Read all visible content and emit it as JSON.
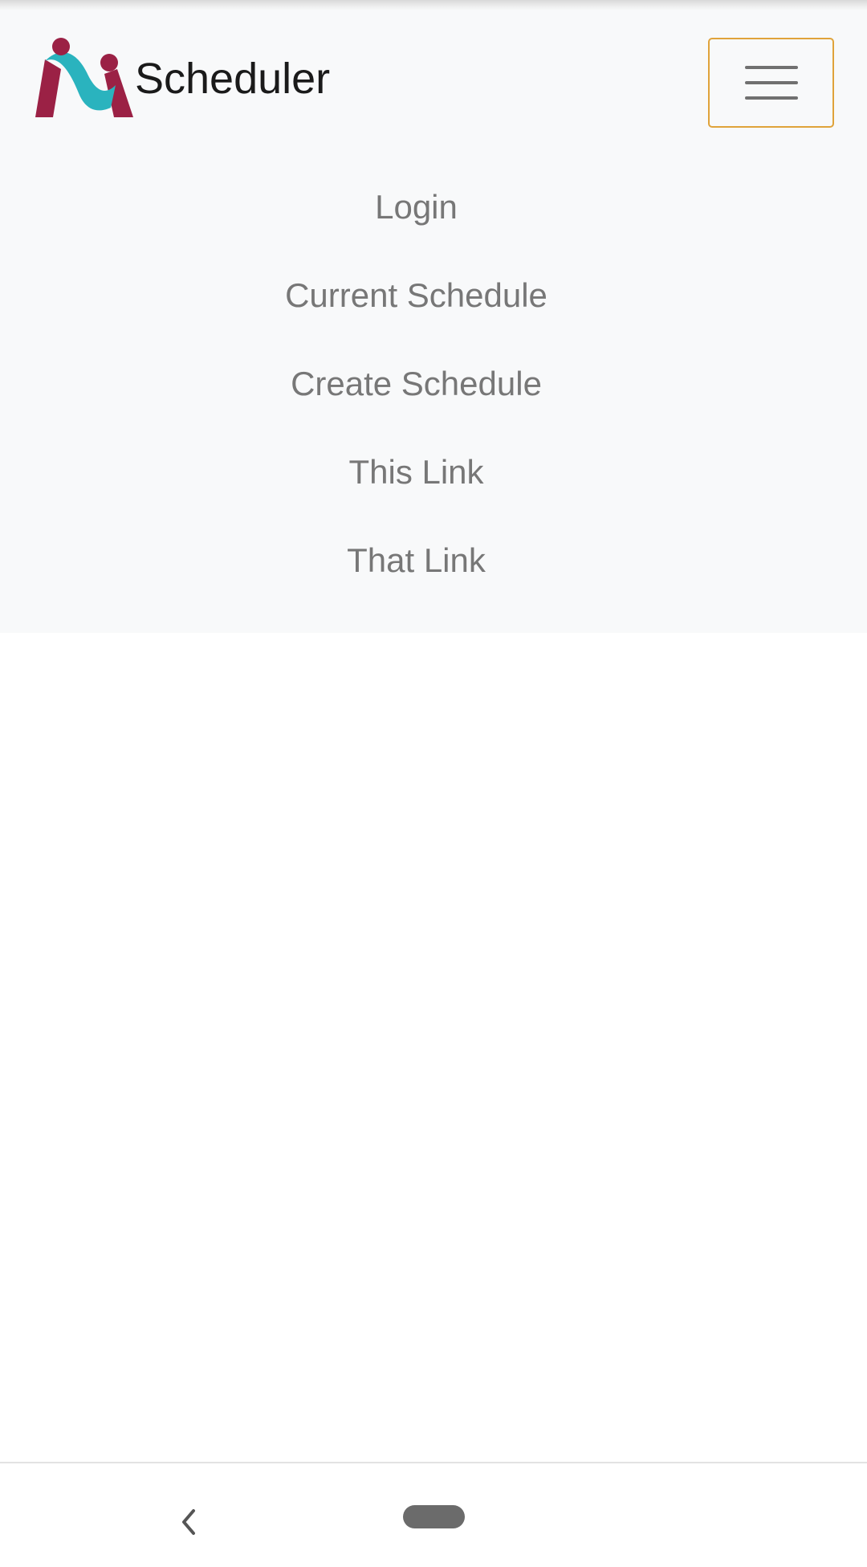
{
  "app": {
    "brand_name": "Scheduler",
    "logo_icon": "scheduler-logo-icon",
    "colors": {
      "logo_teal": "#2ab3be",
      "logo_maroon": "#9b2145",
      "toggler_focus_border": "#e0a33a",
      "navbar_bg": "#f8f9fa",
      "link_text": "#777777"
    }
  },
  "navbar": {
    "toggler_icon": "hamburger-menu-icon",
    "toggler_expanded": true,
    "links": [
      {
        "label": "Login"
      },
      {
        "label": "Current Schedule"
      },
      {
        "label": "Create Schedule"
      },
      {
        "label": "This Link"
      },
      {
        "label": "That Link"
      }
    ]
  },
  "system_nav": {
    "back_icon": "chevron-left-icon",
    "home_icon": "home-pill-icon"
  }
}
